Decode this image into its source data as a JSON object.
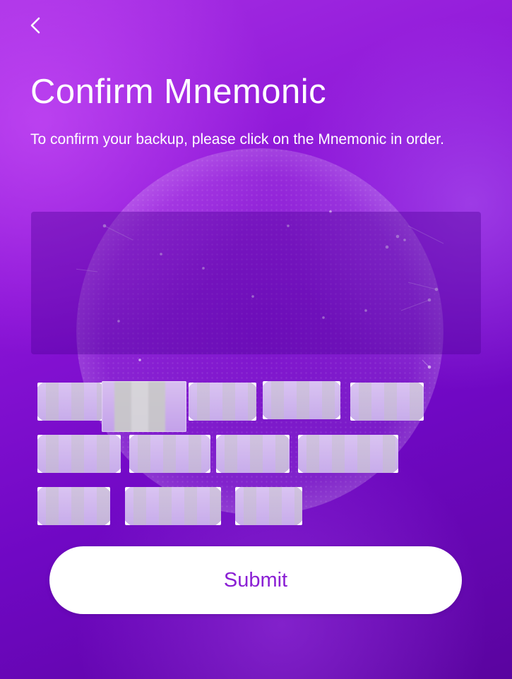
{
  "header": {
    "back_icon": "chevron-left-icon",
    "title": "Confirm Mnemonic",
    "subtitle": "To confirm your backup, please click on the Mnemonic in order."
  },
  "mnemonic": {
    "selected_words": [],
    "word_options": [
      "",
      "",
      "",
      "",
      "",
      "",
      "",
      "",
      "",
      "",
      "",
      ""
    ]
  },
  "actions": {
    "submit_label": "Submit"
  },
  "colors": {
    "background_top": "#a62ee3",
    "background_bottom": "#5a049f",
    "accent": "#8a1fd4",
    "button_bg": "#ffffff"
  }
}
